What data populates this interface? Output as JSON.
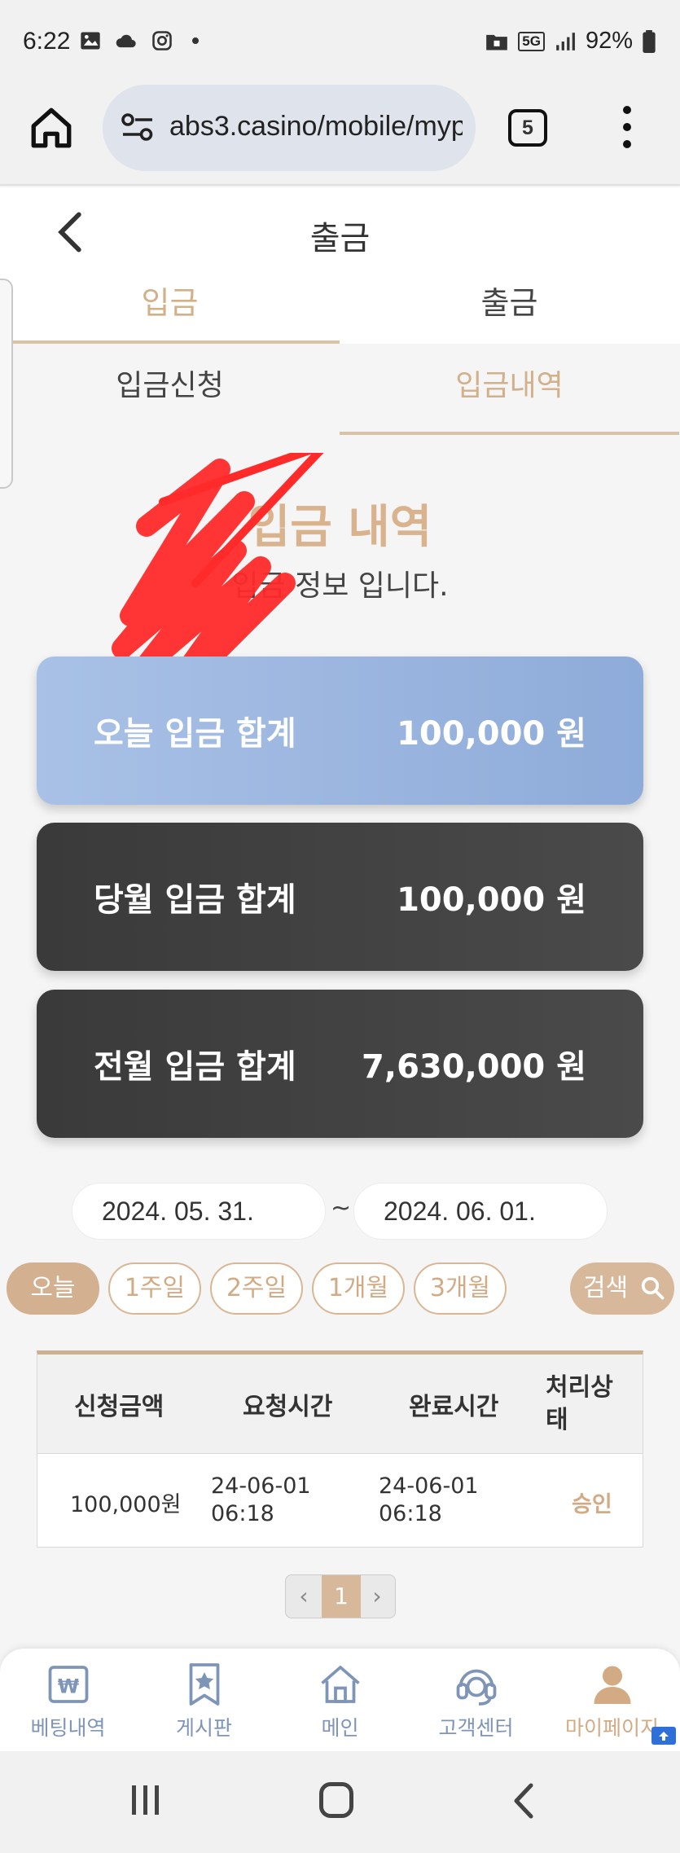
{
  "statusbar": {
    "time": "6:22",
    "battery": "92%",
    "network": "5G"
  },
  "browser": {
    "url": "abs3.casino/mobile/myp",
    "tab_count": "5"
  },
  "header": {
    "title": "출금"
  },
  "main_tabs": [
    {
      "label": "입금",
      "active": true
    },
    {
      "label": "출금",
      "active": false
    }
  ],
  "sub_tabs": [
    {
      "label": "입금신청",
      "active": false
    },
    {
      "label": "입금내역",
      "active": true
    }
  ],
  "section": {
    "title": "입금 내역",
    "description": "입금 정보 입니다."
  },
  "summary_cards": [
    {
      "label": "오늘 입금 합계",
      "value": "100,000 원",
      "style": "blue"
    },
    {
      "label": "당월 입금 합계",
      "value": "100,000 원",
      "style": "dark"
    },
    {
      "label": "전월 입금 합계",
      "value": "7,630,000 원",
      "style": "dark"
    }
  ],
  "date_range": {
    "start": "2024. 05. 31.",
    "separator": "~",
    "end": "2024. 06. 01."
  },
  "period_buttons": [
    {
      "label": "오늘",
      "active": true
    },
    {
      "label": "1주일",
      "active": false
    },
    {
      "label": "2주일",
      "active": false
    },
    {
      "label": "1개월",
      "active": false
    },
    {
      "label": "3개월",
      "active": false
    }
  ],
  "search_button": {
    "label": "검색"
  },
  "table": {
    "headers": [
      "신청금액",
      "요청시간",
      "완료시간",
      "처리상\n태"
    ],
    "rows": [
      {
        "amount": "100,000원",
        "requested_date": "24-06-01",
        "requested_time": "06:18",
        "completed_date": "24-06-01",
        "completed_time": "06:18",
        "status": "승인"
      }
    ]
  },
  "pagination": {
    "prev": "‹",
    "current": "1",
    "next": "›"
  },
  "bottom_nav": [
    {
      "label": "베팅내역",
      "icon": "betting-history-icon",
      "active": false
    },
    {
      "label": "게시판",
      "icon": "board-icon",
      "active": false
    },
    {
      "label": "메인",
      "icon": "home-icon",
      "active": false
    },
    {
      "label": "고객센터",
      "icon": "support-headset-icon",
      "active": false
    },
    {
      "label": "마이페이지",
      "icon": "user-icon",
      "active": true
    }
  ],
  "colors": {
    "accent": "#d2ab84",
    "card_blue": "#97b2de",
    "card_dark": "#404040",
    "nav_blue": "#7f95b8"
  }
}
